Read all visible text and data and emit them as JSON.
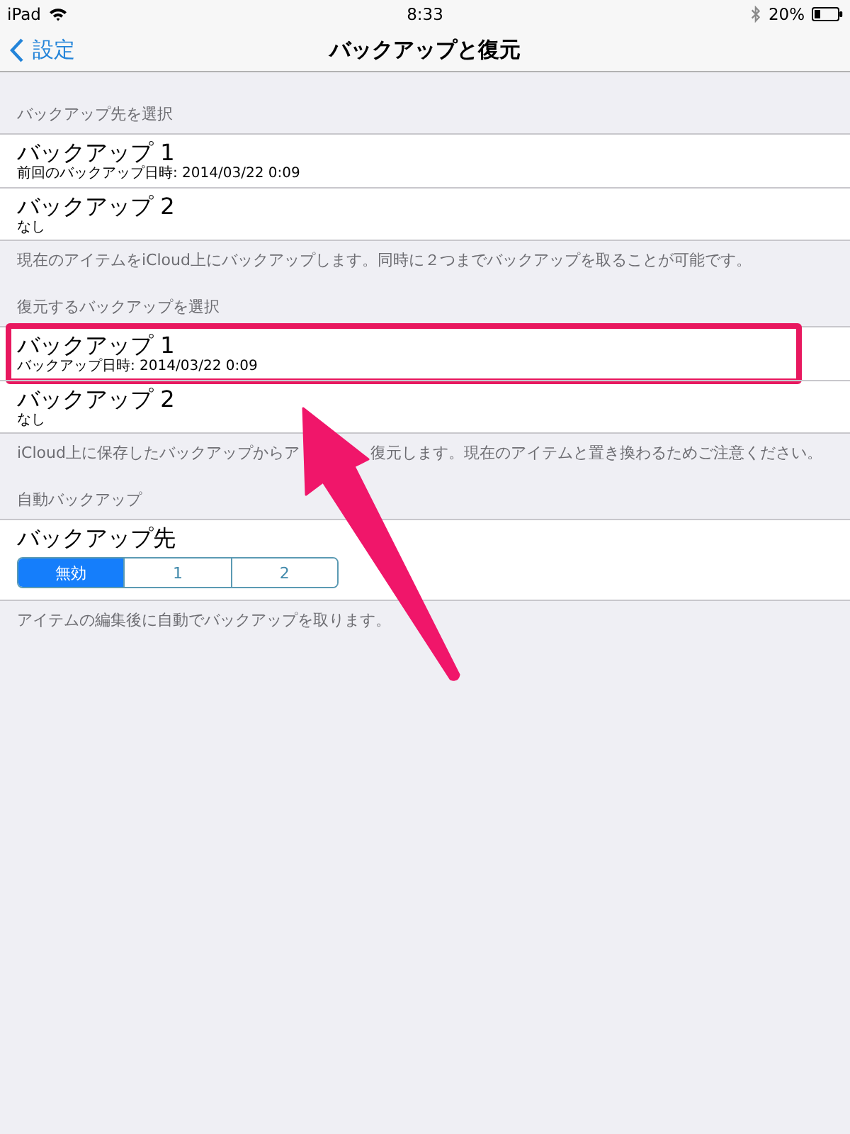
{
  "status_bar": {
    "device": "iPad",
    "time": "8:33",
    "battery_percent": "20%"
  },
  "nav_bar": {
    "back_label": "設定",
    "title": "バックアップと復元"
  },
  "sections": [
    {
      "kind": "list",
      "header": "バックアップ先を選択",
      "items": [
        {
          "title": "バックアップ 1",
          "subtitle": "前回のバックアップ日時: 2014/03/22 0:09",
          "highlighted": false
        },
        {
          "title": "バックアップ 2",
          "subtitle": "なし",
          "highlighted": false
        }
      ],
      "footer": [
        "現在のアイテムをiCloud上にバックアップします。同時に２つまでバックアップを取ることが可能です。"
      ]
    },
    {
      "kind": "list",
      "header": "復元するバックアップを選択",
      "items": [
        {
          "title": "バックアップ 1",
          "subtitle": "バックアップ日時: 2014/03/22 0:09",
          "highlighted": true
        },
        {
          "title": "バックアップ 2",
          "subtitle": "なし",
          "highlighted": false
        }
      ],
      "footer": [
        "iCloud上に保存したバックアップからア",
        "復元します。現在のアイテムと置き換わるためご注意ください。"
      ]
    },
    {
      "kind": "segmented",
      "header": "自動バックアップ",
      "title": "バックアップ先",
      "segments": [
        {
          "label": "無効",
          "selected": true
        },
        {
          "label": "1",
          "selected": false
        },
        {
          "label": "2",
          "selected": false
        }
      ],
      "footer": [
        "アイテムの編集後に自動でバックアップを取ります。"
      ]
    }
  ]
}
